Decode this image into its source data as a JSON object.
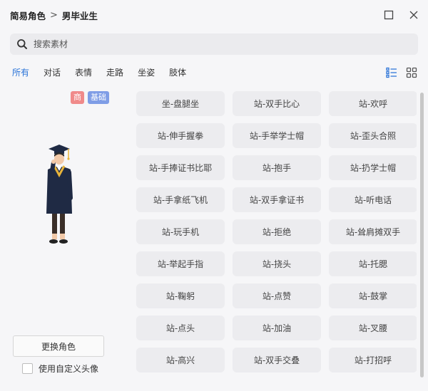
{
  "titlebar": {
    "breadcrumb_root": "简易角色",
    "separator": ">",
    "breadcrumb_current": "男毕业生",
    "maximize_icon": "maximize-icon",
    "close_icon": "close-icon"
  },
  "search": {
    "placeholder": "搜索素材",
    "icon": "search-icon"
  },
  "tabs": [
    "所有",
    "对话",
    "表情",
    "走路",
    "坐姿",
    "肢体"
  ],
  "active_tab": "所有",
  "view_icons": [
    "list-view-icon",
    "grid-view-icon"
  ],
  "accent_color": "#2b74d8",
  "character": {
    "badges": [
      "商",
      "基础"
    ],
    "badge_colors": [
      "#f08a8a",
      "#7f9de6"
    ],
    "change_button": "更换角色",
    "custom_avatar_label": "使用自定义头像",
    "custom_avatar_checked": false
  },
  "poses": [
    "坐-盘腿坐",
    "站-双手比心",
    "站-欢呼",
    "站-伸手握拳",
    "站-手举学士帽",
    "站-歪头合照",
    "站-手捧证书比耶",
    "站-抱手",
    "站-扔学士帽",
    "站-手拿纸飞机",
    "站-双手拿证书",
    "站-听电话",
    "站-玩手机",
    "站-拒绝",
    "站-耸肩摊双手",
    "站-举起手指",
    "站-挠头",
    "站-托腮",
    "站-鞠躬",
    "站-点赞",
    "站-鼓掌",
    "站-点头",
    "站-加油",
    "站-叉腰",
    "站-高兴",
    "站-双手交叠",
    "站-打招呼"
  ]
}
